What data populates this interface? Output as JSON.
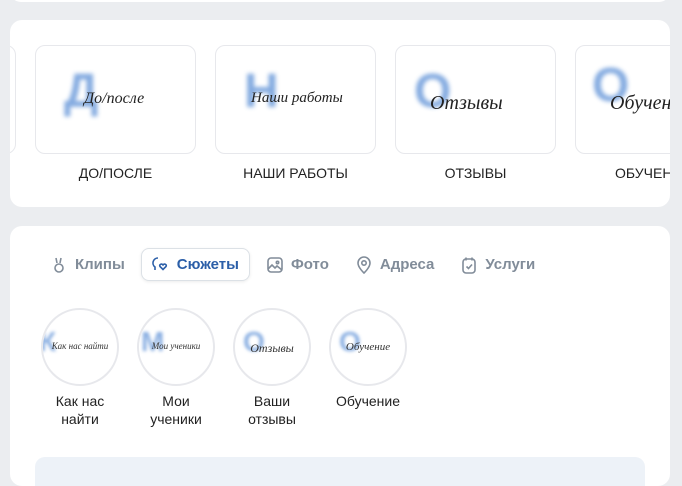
{
  "albums": [
    {
      "initial": "Д",
      "caption": "До/после",
      "label": "ДО/ПОСЛЕ"
    },
    {
      "initial": "Н",
      "caption": "Наши работы",
      "label": "НАШИ РАБОТЫ"
    },
    {
      "initial": "О",
      "caption": "Отзывы",
      "label": "ОТЗЫВЫ"
    },
    {
      "initial": "О",
      "caption": "Обучение",
      "label": "ОБУЧЕНИЕ"
    }
  ],
  "tabs": [
    {
      "label": "Клипы",
      "icon": "clips-icon"
    },
    {
      "label": "Сюжеты",
      "icon": "stories-icon",
      "active": true
    },
    {
      "label": "Фото",
      "icon": "photo-icon"
    },
    {
      "label": "Адреса",
      "icon": "location-icon"
    },
    {
      "label": "Услуги",
      "icon": "services-icon"
    }
  ],
  "stories": [
    {
      "initial": "К",
      "caption": "Как нас найти",
      "label_1": "Как нас",
      "label_2": "найти"
    },
    {
      "initial": "М",
      "caption": "Мои ученики",
      "label_1": "Мои",
      "label_2": "ученики"
    },
    {
      "initial": "О",
      "caption": "Отзывы",
      "label_1": "Ваши",
      "label_2": "отзывы"
    },
    {
      "initial": "О",
      "caption": "Обучение",
      "label_1": "Обучение",
      "label_2": ""
    }
  ]
}
